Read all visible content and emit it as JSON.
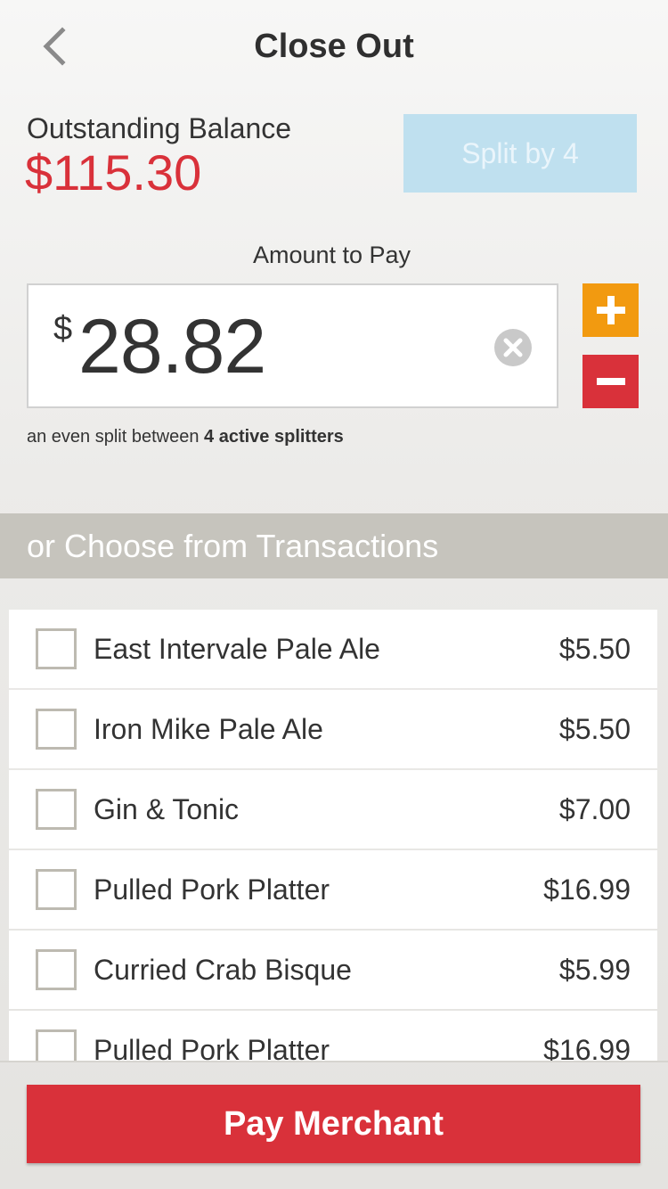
{
  "header": {
    "title": "Close Out",
    "back_icon": "chevron-left-icon"
  },
  "balance": {
    "label": "Outstanding Balance",
    "value": "$115.30",
    "color": "#d9313a"
  },
  "split_button": {
    "label": "Split by 4",
    "color": "#bfe0ef"
  },
  "amount": {
    "label": "Amount to Pay",
    "currency": "$",
    "value": "28.82",
    "clear_icon": "clear-circle-icon",
    "plus_icon": "plus-icon",
    "minus_icon": "minus-icon",
    "plus_color": "#f29a10",
    "minus_color": "#d9313a"
  },
  "hint": {
    "prefix": "an even split between ",
    "bold": "4 active splitters"
  },
  "section": {
    "title": "or Choose from Transactions"
  },
  "transactions": [
    {
      "name": "East Intervale Pale Ale",
      "price": "$5.50"
    },
    {
      "name": "Iron Mike Pale Ale",
      "price": "$5.50"
    },
    {
      "name": "Gin & Tonic",
      "price": "$7.00"
    },
    {
      "name": "Pulled Pork Platter",
      "price": "$16.99"
    },
    {
      "name": "Curried Crab Bisque",
      "price": "$5.99"
    },
    {
      "name": "Pulled Pork Platter",
      "price": "$16.99"
    }
  ],
  "pay_button": {
    "label": "Pay Merchant",
    "color": "#d9313a"
  }
}
